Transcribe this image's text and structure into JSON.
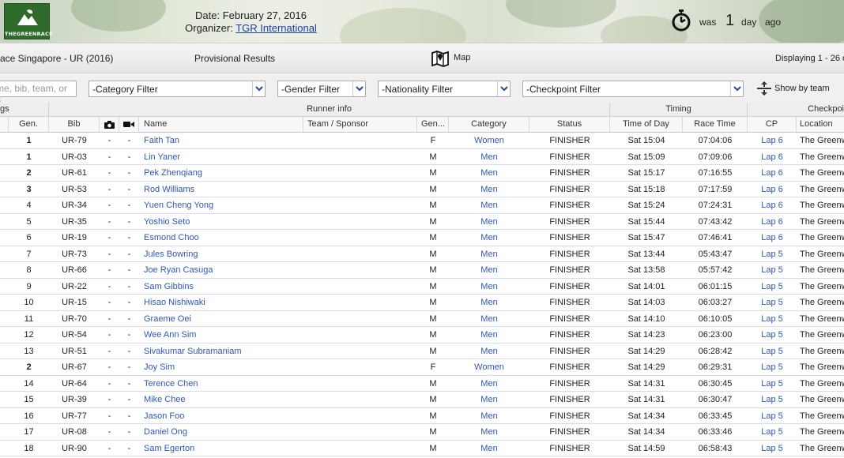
{
  "header": {
    "logo_text": "THEGREENRACE",
    "date_line": "Date: February 27, 2016",
    "organizer_label": "Organizer:",
    "organizer_link": "TGR International",
    "updated_prefix": "was",
    "updated_number": "1",
    "updated_unit": "day",
    "updated_suffix": "ago"
  },
  "titlebar": {
    "race_name": "ace Singapore - UR (2016)",
    "results_label": "Provisional Results",
    "map_label": "Map",
    "display_text": "Displaying 1 - 26 o"
  },
  "filters": {
    "search_placeholder": "me, bib, team, or s",
    "category": "-Category Filter",
    "gender": "-Gender Filter",
    "nationality": "-Nationality Filter",
    "checkpoint": "-Checkpoint Filter",
    "show_by_team": "Show by team"
  },
  "table": {
    "groups": {
      "rankings": "gs",
      "runner_info": "Runner info",
      "timing": "Timing",
      "checkpoint": "Checkpoi"
    },
    "columns": {
      "gen_rank": "Gen.",
      "bib": "Bib",
      "name": "Name",
      "team": "Team / Sponsor",
      "gender": "Gen...",
      "category": "Category",
      "status": "Status",
      "time_of_day": "Time of Day",
      "race_time": "Race Time",
      "cp": "CP",
      "location": "Location"
    },
    "rows": [
      {
        "gen_rank": "1",
        "bib": "UR-79",
        "photo": "-",
        "video": "-",
        "name": "Faith Tan",
        "gender": "F",
        "category": "Women",
        "status": "FINISHER",
        "time_of_day": "Sat 15:04",
        "race_time": "07:04:06",
        "cp": "Lap 6",
        "location": "The Greenw"
      },
      {
        "gen_rank": "1",
        "bib": "UR-03",
        "photo": "-",
        "video": "-",
        "name": "Lin Yaner",
        "gender": "M",
        "category": "Men",
        "status": "FINISHER",
        "time_of_day": "Sat 15:09",
        "race_time": "07:09:06",
        "cp": "Lap 6",
        "location": "The Greenw"
      },
      {
        "gen_rank": "2",
        "bib": "UR-61",
        "photo": "-",
        "video": "-",
        "name": "Pek Zhenqiang",
        "gender": "M",
        "category": "Men",
        "status": "FINISHER",
        "time_of_day": "Sat 15:17",
        "race_time": "07:16:55",
        "cp": "Lap 6",
        "location": "The Greenw"
      },
      {
        "gen_rank": "3",
        "bib": "UR-53",
        "photo": "-",
        "video": "-",
        "name": "Rod Williams",
        "gender": "M",
        "category": "Men",
        "status": "FINISHER",
        "time_of_day": "Sat 15:18",
        "race_time": "07:17:59",
        "cp": "Lap 6",
        "location": "The Greenw"
      },
      {
        "gen_rank": "4",
        "bib": "UR-34",
        "photo": "-",
        "video": "-",
        "name": "Yuen Cheng Yong",
        "gender": "M",
        "category": "Men",
        "status": "FINISHER",
        "time_of_day": "Sat 15:24",
        "race_time": "07:24:31",
        "cp": "Lap 6",
        "location": "The Greenw"
      },
      {
        "gen_rank": "5",
        "bib": "UR-35",
        "photo": "-",
        "video": "-",
        "name": "Yoshio Seto",
        "gender": "M",
        "category": "Men",
        "status": "FINISHER",
        "time_of_day": "Sat 15:44",
        "race_time": "07:43:42",
        "cp": "Lap 6",
        "location": "The Greenw"
      },
      {
        "gen_rank": "6",
        "bib": "UR-19",
        "photo": "-",
        "video": "-",
        "name": "Esmond Choo",
        "gender": "M",
        "category": "Men",
        "status": "FINISHER",
        "time_of_day": "Sat 15:47",
        "race_time": "07:46:41",
        "cp": "Lap 6",
        "location": "The Greenw"
      },
      {
        "gen_rank": "7",
        "bib": "UR-73",
        "photo": "-",
        "video": "-",
        "name": "Jules Bowring",
        "gender": "M",
        "category": "Men",
        "status": "FINISHER",
        "time_of_day": "Sat 13:44",
        "race_time": "05:43:47",
        "cp": "Lap 5",
        "location": "The Greenw"
      },
      {
        "gen_rank": "8",
        "bib": "UR-66",
        "photo": "-",
        "video": "-",
        "name": "Joe Ryan Casuga",
        "gender": "M",
        "category": "Men",
        "status": "FINISHER",
        "time_of_day": "Sat 13:58",
        "race_time": "05:57:42",
        "cp": "Lap 5",
        "location": "The Greenw"
      },
      {
        "gen_rank": "9",
        "bib": "UR-22",
        "photo": "-",
        "video": "-",
        "name": "Sam Gibbins",
        "gender": "M",
        "category": "Men",
        "status": "FINISHER",
        "time_of_day": "Sat 14:01",
        "race_time": "06:01:15",
        "cp": "Lap 5",
        "location": "The Greenw"
      },
      {
        "gen_rank": "10",
        "bib": "UR-15",
        "photo": "-",
        "video": "-",
        "name": "Hisao Nishiwaki",
        "gender": "M",
        "category": "Men",
        "status": "FINISHER",
        "time_of_day": "Sat 14:03",
        "race_time": "06:03:27",
        "cp": "Lap 5",
        "location": "The Greenw"
      },
      {
        "gen_rank": "11",
        "bib": "UR-70",
        "photo": "-",
        "video": "-",
        "name": "Graeme Oei",
        "gender": "M",
        "category": "Men",
        "status": "FINISHER",
        "time_of_day": "Sat 14:10",
        "race_time": "06:10:05",
        "cp": "Lap 5",
        "location": "The Greenw"
      },
      {
        "gen_rank": "12",
        "bib": "UR-54",
        "photo": "-",
        "video": "-",
        "name": "Wee Ann Sim",
        "gender": "M",
        "category": "Men",
        "status": "FINISHER",
        "time_of_day": "Sat 14:23",
        "race_time": "06:23:00",
        "cp": "Lap 5",
        "location": "The Greenw"
      },
      {
        "gen_rank": "13",
        "bib": "UR-51",
        "photo": "-",
        "video": "-",
        "name": "Sivakumar Subramaniam",
        "gender": "M",
        "category": "Men",
        "status": "FINISHER",
        "time_of_day": "Sat 14:29",
        "race_time": "06:28:42",
        "cp": "Lap 5",
        "location": "The Greenw"
      },
      {
        "gen_rank": "2",
        "bib": "UR-67",
        "photo": "-",
        "video": "-",
        "name": "Joy Sim",
        "gender": "F",
        "category": "Women",
        "status": "FINISHER",
        "time_of_day": "Sat 14:29",
        "race_time": "06:29:31",
        "cp": "Lap 5",
        "location": "The Greenw"
      },
      {
        "gen_rank": "14",
        "bib": "UR-64",
        "photo": "-",
        "video": "-",
        "name": "Terence Chen",
        "gender": "M",
        "category": "Men",
        "status": "FINISHER",
        "time_of_day": "Sat 14:31",
        "race_time": "06:30:45",
        "cp": "Lap 5",
        "location": "The Greenw"
      },
      {
        "gen_rank": "15",
        "bib": "UR-39",
        "photo": "-",
        "video": "-",
        "name": "Mike Chee",
        "gender": "M",
        "category": "Men",
        "status": "FINISHER",
        "time_of_day": "Sat 14:31",
        "race_time": "06:30:47",
        "cp": "Lap 5",
        "location": "The Greenw"
      },
      {
        "gen_rank": "16",
        "bib": "UR-77",
        "photo": "-",
        "video": "-",
        "name": "Jason Foo",
        "gender": "M",
        "category": "Men",
        "status": "FINISHER",
        "time_of_day": "Sat 14:34",
        "race_time": "06:33:45",
        "cp": "Lap 5",
        "location": "The Greenw"
      },
      {
        "gen_rank": "17",
        "bib": "UR-08",
        "photo": "-",
        "video": "-",
        "name": "Daniel Ong",
        "gender": "M",
        "category": "Men",
        "status": "FINISHER",
        "time_of_day": "Sat 14:34",
        "race_time": "06:33:46",
        "cp": "Lap 5",
        "location": "The Greenw"
      },
      {
        "gen_rank": "18",
        "bib": "UR-90",
        "photo": "-",
        "video": "-",
        "name": "Sam Egerton",
        "gender": "M",
        "category": "Men",
        "status": "FINISHER",
        "time_of_day": "Sat 14:59",
        "race_time": "06:58:43",
        "cp": "Lap 5",
        "location": "The Greenw"
      }
    ]
  },
  "colors": {
    "link": "#2f57b5",
    "organizer_link": "#1a3fa8",
    "logo_green": "#2e6b2a"
  },
  "icons": {
    "stopwatch": "stopwatch-icon",
    "map": "map-icon",
    "camera": "camera-icon",
    "video": "video-camera-icon",
    "team_toggle": "expand-collapse-icon",
    "dropdown": "chevron-down-icon"
  }
}
